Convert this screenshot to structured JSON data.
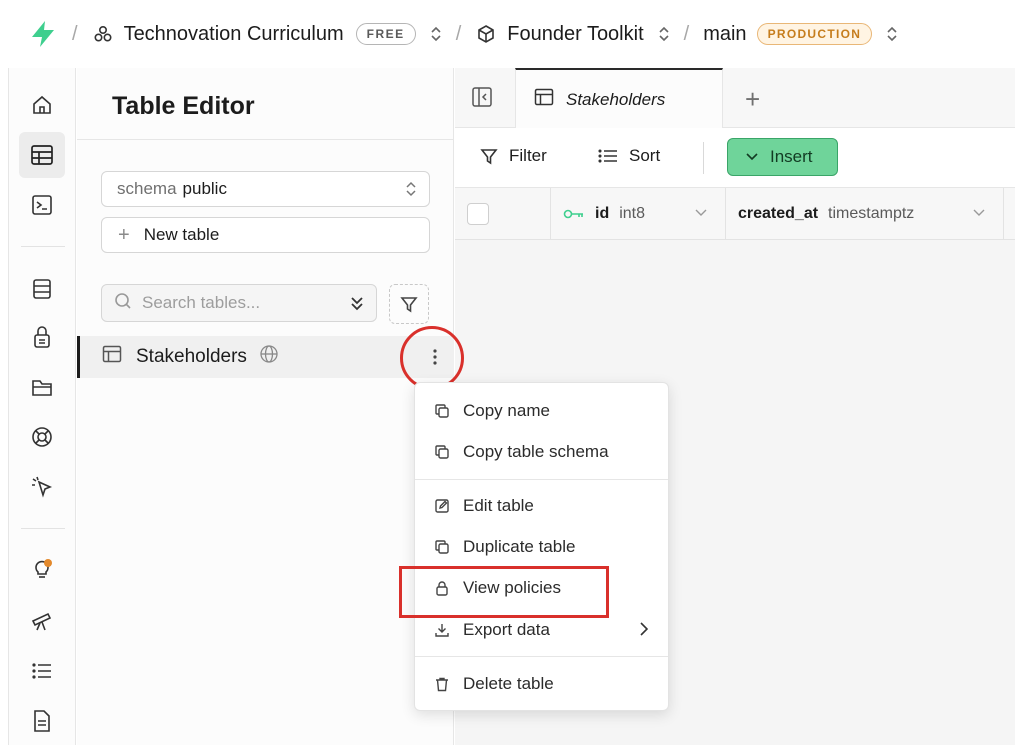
{
  "colors": {
    "brand": "#3ecf8e",
    "accent_insert": "#6fd49a",
    "highlight_red": "#d9302b",
    "production_badge": "#c67d1d"
  },
  "topbar": {
    "logo_icon": "supabase-bolt-icon",
    "org": "Technovation Curriculum",
    "org_badge": "FREE",
    "project": "Founder Toolkit",
    "branch": "main",
    "branch_badge": "PRODUCTION",
    "separator": "/"
  },
  "rail": {
    "items": [
      "home-icon",
      "table-editor-icon",
      "sql-editor-icon",
      "database-icon",
      "auth-icon",
      "storage-icon",
      "realtime-icon",
      "edge-functions-icon",
      "advisors-icon",
      "reports-icon",
      "logs-icon",
      "docs-icon"
    ]
  },
  "panel": {
    "title": "Table Editor",
    "schema_label": "schema",
    "schema_value": "public",
    "new_table": "New table",
    "search_placeholder": "Search tables...",
    "table_name": "Stakeholders"
  },
  "tabs": {
    "active_label": "Stakeholders",
    "add": "+"
  },
  "toolbar": {
    "filter": "Filter",
    "sort": "Sort",
    "insert": "Insert"
  },
  "grid": {
    "columns": [
      {
        "name": "id",
        "type": "int8",
        "primary_key": true
      },
      {
        "name": "created_at",
        "type": "timestamptz",
        "primary_key": false
      }
    ]
  },
  "context_menu": {
    "items": [
      {
        "label": "Copy name",
        "icon": "copy-icon"
      },
      {
        "label": "Copy table schema",
        "icon": "copy-icon"
      },
      {
        "label": "Edit table",
        "icon": "edit-icon"
      },
      {
        "label": "Duplicate table",
        "icon": "copy-icon"
      },
      {
        "label": "View policies",
        "icon": "lock-icon"
      },
      {
        "label": "Export data",
        "icon": "download-icon"
      },
      {
        "label": "Delete table",
        "icon": "trash-icon"
      }
    ]
  }
}
